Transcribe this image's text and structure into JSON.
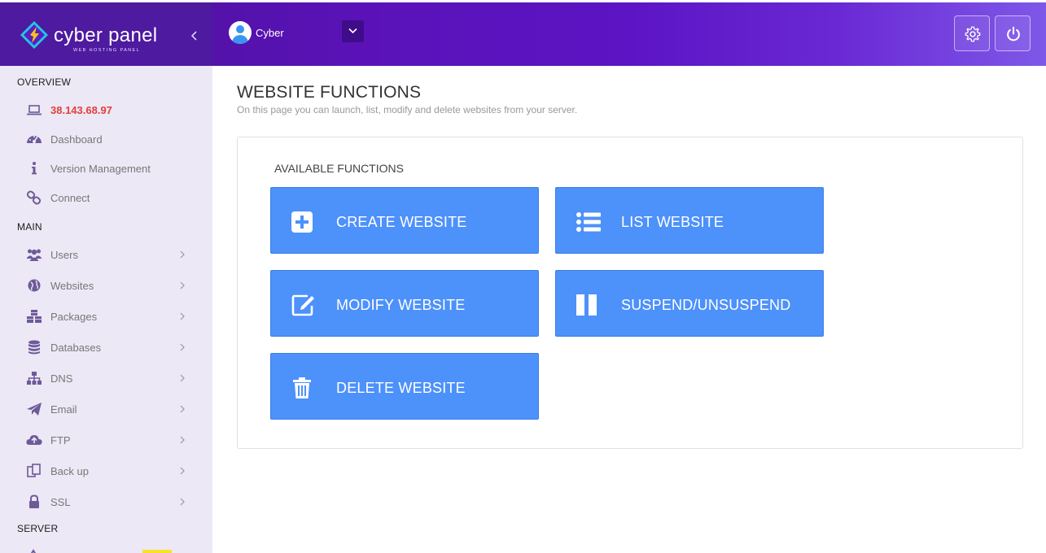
{
  "header": {
    "brand_name": "cyber panel",
    "brand_sub": "WEB HOSTING PANEL",
    "user_name": "Cyber"
  },
  "sidebar": {
    "overview_title": "OVERVIEW",
    "overview_items": [
      {
        "label": "38.143.68.97",
        "icon": "laptop-icon"
      },
      {
        "label": "Dashboard",
        "icon": "dashboard-icon"
      },
      {
        "label": "Version Management",
        "icon": "info-icon"
      },
      {
        "label": "Connect",
        "icon": "link-icon"
      }
    ],
    "main_title": "MAIN",
    "main_items": [
      {
        "label": "Users",
        "icon": "users-icon"
      },
      {
        "label": "Websites",
        "icon": "globe-icon"
      },
      {
        "label": "Packages",
        "icon": "cubes-icon"
      },
      {
        "label": "Databases",
        "icon": "database-icon"
      },
      {
        "label": "DNS",
        "icon": "sitemap-icon"
      },
      {
        "label": "Email",
        "icon": "paper-plane-icon"
      },
      {
        "label": "FTP",
        "icon": "cloud-upload-icon"
      },
      {
        "label": "Back up",
        "icon": "copy-icon"
      },
      {
        "label": "SSL",
        "icon": "lock-icon"
      }
    ],
    "server_title": "SERVER"
  },
  "main": {
    "title": "WEBSITE FUNCTIONS",
    "subtitle": "On this page you can launch, list, modify and delete websites from your server.",
    "panel_title": "AVAILABLE FUNCTIONS",
    "functions": [
      {
        "label": "CREATE WEBSITE",
        "icon": "plus-square-icon"
      },
      {
        "label": "LIST WEBSITE",
        "icon": "list-icon"
      },
      {
        "label": "MODIFY WEBSITE",
        "icon": "edit-icon"
      },
      {
        "label": "SUSPEND/UNSUSPEND",
        "icon": "pause-icon"
      },
      {
        "label": "DELETE WEBSITE",
        "icon": "trash-icon"
      }
    ]
  },
  "colors": {
    "accent_blue": "#4d91fa",
    "header_purple": "#5a12b8",
    "ip_red": "#e0403a",
    "sidebar_bg": "#ece8f5"
  }
}
